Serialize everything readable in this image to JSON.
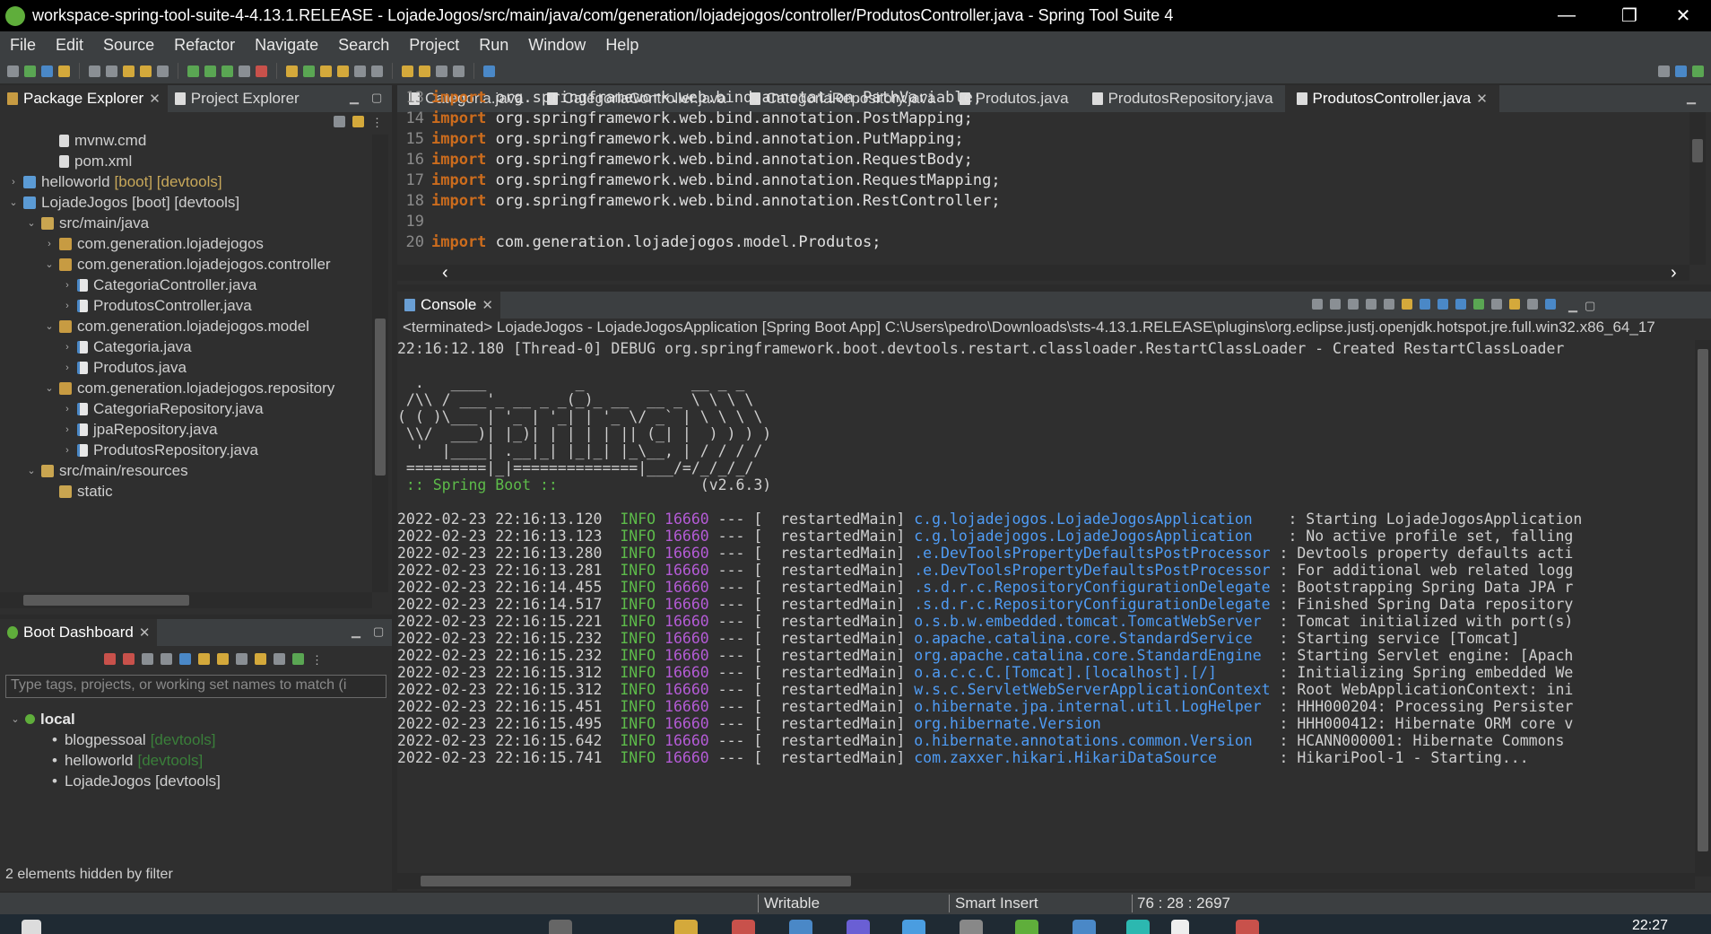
{
  "window": {
    "title": "workspace-spring-tool-suite-4-4.13.1.RELEASE - LojadeJogos/src/main/java/com/generation/lojadejogos/controller/ProdutosController.java - Spring Tool Suite 4",
    "minimize": "—",
    "restore": "❐",
    "close": "✕"
  },
  "menu": [
    "File",
    "Edit",
    "Source",
    "Refactor",
    "Navigate",
    "Search",
    "Project",
    "Run",
    "Window",
    "Help"
  ],
  "explorer": {
    "tabs": [
      {
        "label": "Package Explorer",
        "closable": "✕"
      },
      {
        "label": "Project Explorer"
      }
    ],
    "tree": [
      {
        "indent": 3,
        "arrow": "",
        "icon": "file",
        "label": "mvnw.cmd"
      },
      {
        "indent": 3,
        "arrow": "",
        "icon": "file",
        "label": "pom.xml"
      },
      {
        "indent": 1,
        "arrow": "›",
        "icon": "proj",
        "label": "helloworld",
        "deco": "[boot] [devtools]"
      },
      {
        "indent": 1,
        "arrow": "⌄",
        "icon": "proj",
        "label": "LojadeJogos [boot] [devtools]"
      },
      {
        "indent": 2,
        "arrow": "⌄",
        "icon": "src",
        "label": "src/main/java"
      },
      {
        "indent": 3,
        "arrow": "›",
        "icon": "pkg",
        "label": "com.generation.lojadejogos"
      },
      {
        "indent": 3,
        "arrow": "⌄",
        "icon": "pkg",
        "label": "com.generation.lojadejogos.controller"
      },
      {
        "indent": 4,
        "arrow": "›",
        "icon": "java",
        "label": "CategoriaController.java"
      },
      {
        "indent": 4,
        "arrow": "›",
        "icon": "java",
        "label": "ProdutosController.java"
      },
      {
        "indent": 3,
        "arrow": "⌄",
        "icon": "pkg",
        "label": "com.generation.lojadejogos.model"
      },
      {
        "indent": 4,
        "arrow": "›",
        "icon": "java",
        "label": "Categoria.java"
      },
      {
        "indent": 4,
        "arrow": "›",
        "icon": "java",
        "label": "Produtos.java"
      },
      {
        "indent": 3,
        "arrow": "⌄",
        "icon": "pkg",
        "label": "com.generation.lojadejogos.repository"
      },
      {
        "indent": 4,
        "arrow": "›",
        "icon": "java",
        "label": "CategoriaRepository.java"
      },
      {
        "indent": 4,
        "arrow": "›",
        "icon": "java",
        "label": "jpaRepository.java"
      },
      {
        "indent": 4,
        "arrow": "›",
        "icon": "java",
        "label": "ProdutosRepository.java"
      },
      {
        "indent": 2,
        "arrow": "⌄",
        "icon": "src",
        "label": "src/main/resources"
      },
      {
        "indent": 3,
        "arrow": "",
        "icon": "folder",
        "label": "static"
      }
    ]
  },
  "boot_dashboard": {
    "tab": "Boot Dashboard",
    "close": "✕",
    "search_placeholder": "Type tags, projects, or working set names to match (i",
    "group": "local",
    "group_arrow": "⌄",
    "apps": [
      {
        "label": "blogpessoal",
        "deco": "[devtools]"
      },
      {
        "label": "helloworld",
        "deco": "[devtools]"
      },
      {
        "label": "LojadeJogos [devtools]",
        "deco": ""
      }
    ],
    "filter_note": "2 elements hidden by filter",
    "bullet": "•"
  },
  "editor": {
    "tabs": [
      {
        "label": "Categoria.java",
        "active": false
      },
      {
        "label": "CategoriaController.java",
        "active": false
      },
      {
        "label": "CategoriaRepository.java",
        "active": false
      },
      {
        "label": "Produtos.java",
        "active": false
      },
      {
        "label": "ProdutosRepository.java",
        "active": false
      },
      {
        "label": "ProdutosController.java",
        "active": true
      }
    ],
    "tab_close": "✕",
    "lines": [
      {
        "num": "13",
        "kw": "import",
        "rest": " org.springframework.web.bind.annotation.PathVariable;"
      },
      {
        "num": "14",
        "kw": "import",
        "rest": " org.springframework.web.bind.annotation.PostMapping;"
      },
      {
        "num": "15",
        "kw": "import",
        "rest": " org.springframework.web.bind.annotation.PutMapping;"
      },
      {
        "num": "16",
        "kw": "import",
        "rest": " org.springframework.web.bind.annotation.RequestBody;"
      },
      {
        "num": "17",
        "kw": "import",
        "rest": " org.springframework.web.bind.annotation.RequestMapping;"
      },
      {
        "num": "18",
        "kw": "import",
        "rest": " org.springframework.web.bind.annotation.RestController;"
      },
      {
        "num": "19",
        "kw": "",
        "rest": ""
      },
      {
        "num": "20",
        "kw": "import",
        "rest": " com.generation.lojadejogos.model.Produtos;"
      }
    ],
    "scroll_left": "‹",
    "scroll_right": "›"
  },
  "console": {
    "tab": "Console",
    "close": "✕",
    "info": "<terminated> LojadeJogos - LojadeJogosApplication [Spring Boot App] C:\\Users\\pedro\\Downloads\\sts-4.13.1.RELEASE\\plugins\\org.eclipse.justj.openjdk.hotspot.jre.full.win32.x86_64_17",
    "first_line": "22:16:12.180 [Thread-0] DEBUG org.springframework.boot.devtools.restart.classloader.RestartClassLoader - Created RestartClassLoader",
    "banner": [
      "  .   ____          _            __ _ _",
      " /\\\\ / ___'_ __ _ _(_)_ __  __ _ \\ \\ \\ \\",
      "( ( )\\___ | '_ | '_| | '_ \\/ _` | \\ \\ \\ \\",
      " \\\\/  ___)| |_)| | | | | || (_| |  ) ) ) )",
      "  '  |____| .__|_| |_|_| |_\\__, | / / / /",
      " =========|_|==============|___/=/_/_/_/"
    ],
    "boot_label": " :: Spring Boot :: ",
    "boot_version": "               (v2.6.3)",
    "logs": [
      {
        "ts": "2022-02-23 22:16:13.120",
        "pid": "16660",
        "logger": "c.g.lojadejogos.LojadeJogosApplication   ",
        "msg": ": Starting LojadeJogosApplication"
      },
      {
        "ts": "2022-02-23 22:16:13.123",
        "pid": "16660",
        "logger": "c.g.lojadejogos.LojadeJogosApplication   ",
        "msg": ": No active profile set, falling"
      },
      {
        "ts": "2022-02-23 22:16:13.280",
        "pid": "16660",
        "logger": ".e.DevToolsPropertyDefaultsPostProcessor",
        "msg": ": Devtools property defaults acti"
      },
      {
        "ts": "2022-02-23 22:16:13.281",
        "pid": "16660",
        "logger": ".e.DevToolsPropertyDefaultsPostProcessor",
        "msg": ": For additional web related logg"
      },
      {
        "ts": "2022-02-23 22:16:14.455",
        "pid": "16660",
        "logger": ".s.d.r.c.RepositoryConfigurationDelegate",
        "msg": ": Bootstrapping Spring Data JPA r"
      },
      {
        "ts": "2022-02-23 22:16:14.517",
        "pid": "16660",
        "logger": ".s.d.r.c.RepositoryConfigurationDelegate",
        "msg": ": Finished Spring Data repository"
      },
      {
        "ts": "2022-02-23 22:16:15.221",
        "pid": "16660",
        "logger": "o.s.b.w.embedded.tomcat.TomcatWebServer ",
        "msg": ": Tomcat initialized with port(s)"
      },
      {
        "ts": "2022-02-23 22:16:15.232",
        "pid": "16660",
        "logger": "o.apache.catalina.core.StandardService  ",
        "msg": ": Starting service [Tomcat]"
      },
      {
        "ts": "2022-02-23 22:16:15.232",
        "pid": "16660",
        "logger": "org.apache.catalina.core.StandardEngine ",
        "msg": ": Starting Servlet engine: [Apach"
      },
      {
        "ts": "2022-02-23 22:16:15.312",
        "pid": "16660",
        "logger": "o.a.c.c.C.[Tomcat].[localhost].[/]      ",
        "msg": ": Initializing Spring embedded We"
      },
      {
        "ts": "2022-02-23 22:16:15.312",
        "pid": "16660",
        "logger": "w.s.c.ServletWebServerApplicationContext",
        "msg": ": Root WebApplicationContext: ini"
      },
      {
        "ts": "2022-02-23 22:16:15.451",
        "pid": "16660",
        "logger": "o.hibernate.jpa.internal.util.LogHelper ",
        "msg": ": HHH000204: Processing Persister"
      },
      {
        "ts": "2022-02-23 22:16:15.495",
        "pid": "16660",
        "logger": "org.hibernate.Version                   ",
        "msg": ": HHH000412: Hibernate ORM core v"
      },
      {
        "ts": "2022-02-23 22:16:15.642",
        "pid": "16660",
        "logger": "o.hibernate.annotations.common.Version  ",
        "msg": ": HCANN000001: Hibernate Commons"
      },
      {
        "ts": "2022-02-23 22:16:15.741",
        "pid": "16660",
        "logger": "com.zaxxer.hikari.HikariDataSource      ",
        "msg": ": HikariPool-1 - Starting..."
      }
    ],
    "level": "INFO",
    "sep": " --- [  restartedMain] "
  },
  "status": {
    "writable": "Writable",
    "insert_mode": "Smart Insert",
    "position": "76 : 28 : 2697"
  },
  "taskbar": {
    "time": "22:27"
  },
  "colors": {
    "accent": "#5fae3b",
    "log_info": "#5dbb4a",
    "log_pid": "#b45bd6",
    "log_logger": "#4f9cf5",
    "keyword": "#cc6c1d"
  }
}
